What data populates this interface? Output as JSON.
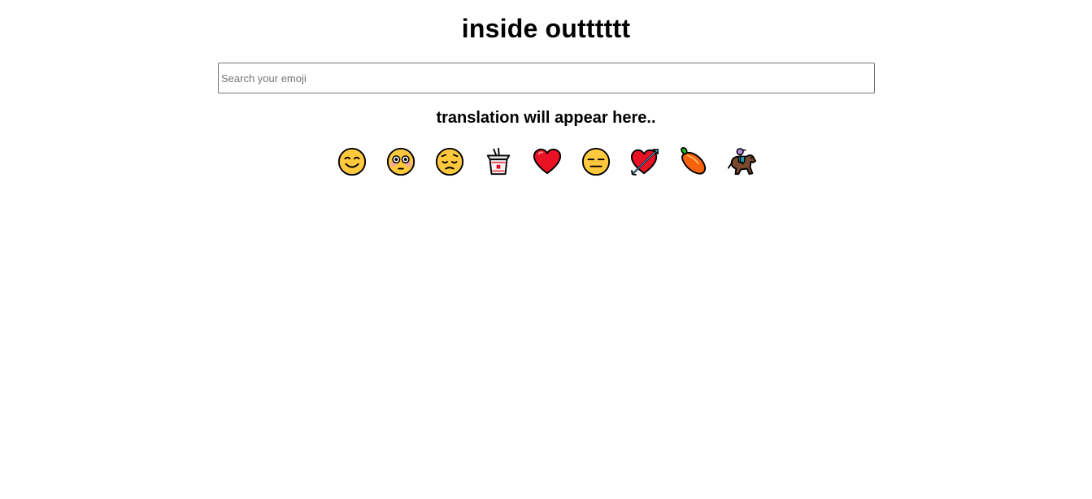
{
  "header": {
    "title": "inside outttttt"
  },
  "search": {
    "placeholder": "Search your emoji",
    "value": ""
  },
  "output": {
    "translation": "translation will appear here.."
  },
  "emojis": [
    {
      "char": "😊",
      "icon": "smiling-face-icon"
    },
    {
      "char": "😳",
      "icon": "flushed-face-icon"
    },
    {
      "char": "😔",
      "icon": "pensive-face-icon"
    },
    {
      "char": "🥡",
      "icon": "takeout-box-icon"
    },
    {
      "char": "❤️",
      "icon": "red-heart-icon"
    },
    {
      "char": "😑",
      "icon": "expressionless-face-icon"
    },
    {
      "char": "💘",
      "icon": "heart-with-arrow-icon"
    },
    {
      "char": "🥭",
      "icon": "mango-icon"
    },
    {
      "char": "🏇",
      "icon": "horse-racing-icon"
    }
  ],
  "colors": {
    "face": "#FFC83D",
    "outline": "#000000",
    "heart": "#E81224",
    "mango": "#F7630C",
    "leaf": "#16C60C",
    "horse": "#7A4A2E"
  }
}
